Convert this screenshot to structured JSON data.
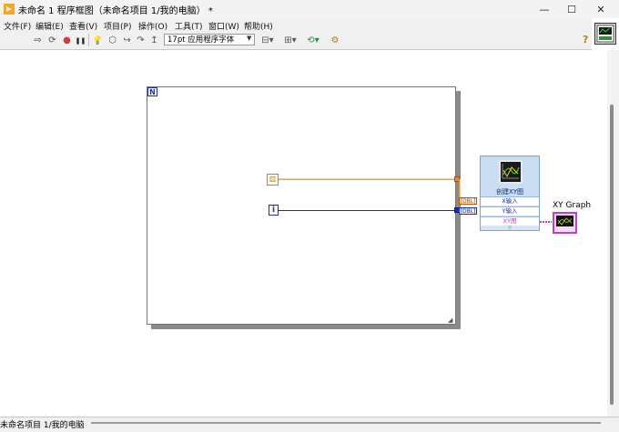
{
  "window": {
    "title": "未命名 1 程序框图（未命名项目 1/我的电脑） *",
    "minimize_glyph": "—",
    "maximize_glyph": "☐",
    "close_glyph": "✕"
  },
  "menu": {
    "items": [
      {
        "label": "文件(F)"
      },
      {
        "label": "编辑(E)"
      },
      {
        "label": "查看(V)"
      },
      {
        "label": "项目(P)"
      },
      {
        "label": "操作(O)"
      },
      {
        "label": "工具(T)"
      },
      {
        "label": "窗口(W)"
      },
      {
        "label": "帮助(H)"
      }
    ]
  },
  "toolbar": {
    "run_glyph": "⇨",
    "run_continuous_glyph": "⟳",
    "abort_glyph": "●",
    "pause_glyph": "❚❚",
    "highlight_glyph": "💡",
    "retain_glyph": "⬡",
    "step_into_glyph": "↪",
    "step_over_glyph": "↷",
    "step_out_glyph": "↥",
    "font_select": "17pt 应用程序字体",
    "font_arrow": "▼",
    "align_glyph": "⊟▾",
    "distribute_glyph": "⊞▾",
    "reorder_glyph": "⟲▾",
    "cleanup_glyph": "⚙",
    "help_glyph": "?"
  },
  "diagram": {
    "loop_count_label": "N",
    "iteration_label": "i",
    "random_glyph": "⚄",
    "array_tag": "[DBL]",
    "express_vi_title": "创建XY图",
    "express_vi_rows": [
      "X输入",
      "Y输入",
      "XY图"
    ],
    "express_vi_more": "▽",
    "graph_label": "XY Graph"
  },
  "status": {
    "context": "未命名项目 1/我的电脑"
  },
  "colors": {
    "double_wire": "#e08a3a",
    "integer_wire": "#1a2fb0",
    "cluster_wire": "#c040c0",
    "express_vi_bg": "#c9def2"
  }
}
